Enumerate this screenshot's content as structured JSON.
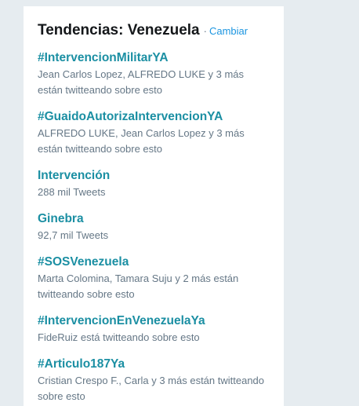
{
  "header": {
    "title": "Tendencias: Venezuela",
    "separator": "·",
    "change_label": "Cambiar"
  },
  "trends": [
    {
      "name": "#IntervencionMilitarYA",
      "meta": "Jean Carlos Lopez, ALFREDO LUKE y 3 más están twitteando sobre esto"
    },
    {
      "name": "#GuaidoAutorizaIntervencionYA",
      "meta": "ALFREDO LUKE, Jean Carlos Lopez y 3 más están twitteando sobre esto"
    },
    {
      "name": "Intervención",
      "meta": "288 mil Tweets"
    },
    {
      "name": "Ginebra",
      "meta": "92,7 mil Tweets"
    },
    {
      "name": "#SOSVenezuela",
      "meta": "Marta Colomina, Tamara Suju y 2 más están twitteando sobre esto"
    },
    {
      "name": "#IntervencionEnVenezuelaYa",
      "meta": "FideRuiz está twitteando sobre esto"
    },
    {
      "name": "#Articulo187Ya",
      "meta": "Cristian Crespo F., Carla y 3 más están twitteando sobre esto"
    }
  ]
}
